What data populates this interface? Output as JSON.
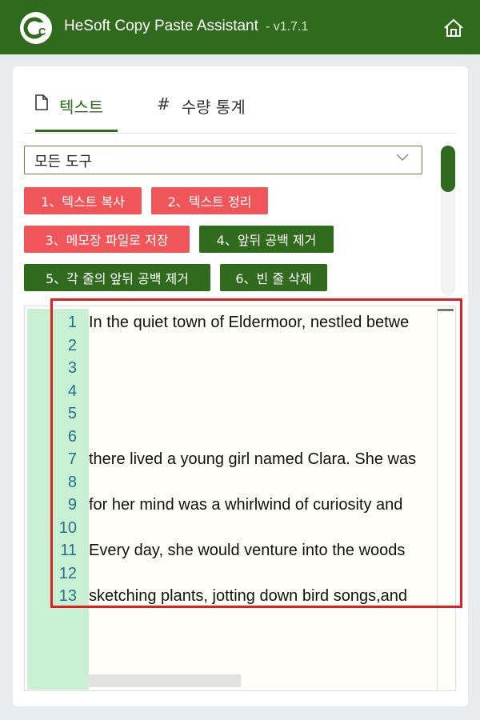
{
  "titlebar": {
    "title": "HeSoft Copy Paste Assistant",
    "version": "- v1.7.1",
    "logo_icon": "logo-icon",
    "home_icon": "home-icon",
    "bg_color": "#2f6a1d"
  },
  "tabs": [
    {
      "label": "텍스트",
      "icon": "document-icon",
      "active": true
    },
    {
      "label": "수량 통계",
      "icon": "hash-icon",
      "active": false
    }
  ],
  "tool_select": {
    "value": "모든 도구"
  },
  "tools": [
    {
      "label": "1、텍스트 복사",
      "color": "red"
    },
    {
      "label": "2、텍스트 정리",
      "color": "red"
    },
    {
      "label": "3、메모장 파일로 저장",
      "color": "red"
    },
    {
      "label": "4、앞뒤 공백 제거",
      "color": "green"
    },
    {
      "label": "5、각 줄의 앞뒤 공백 제거",
      "color": "green"
    },
    {
      "label": "6、빈 줄 삭제",
      "color": "green"
    }
  ],
  "editor": {
    "line_numbers": [
      "1",
      "2",
      "3",
      "4",
      "5",
      "6",
      "7",
      "8",
      "9",
      "10",
      "11",
      "12",
      "13"
    ],
    "lines": [
      "In the quiet town of Eldermoor, nestled betwe",
      "",
      "",
      "",
      "",
      "",
      "there lived a young girl named Clara. She was",
      "",
      "for her mind was a whirlwind of curiosity and",
      "",
      "Every day, she would venture into the woods",
      "",
      "sketching plants, jotting down bird songs,and"
    ]
  },
  "colors": {
    "accent": "#2f6a1d",
    "red_button": "#f0555a",
    "gutter": "#c8f0d2",
    "highlight": "#e02020"
  }
}
